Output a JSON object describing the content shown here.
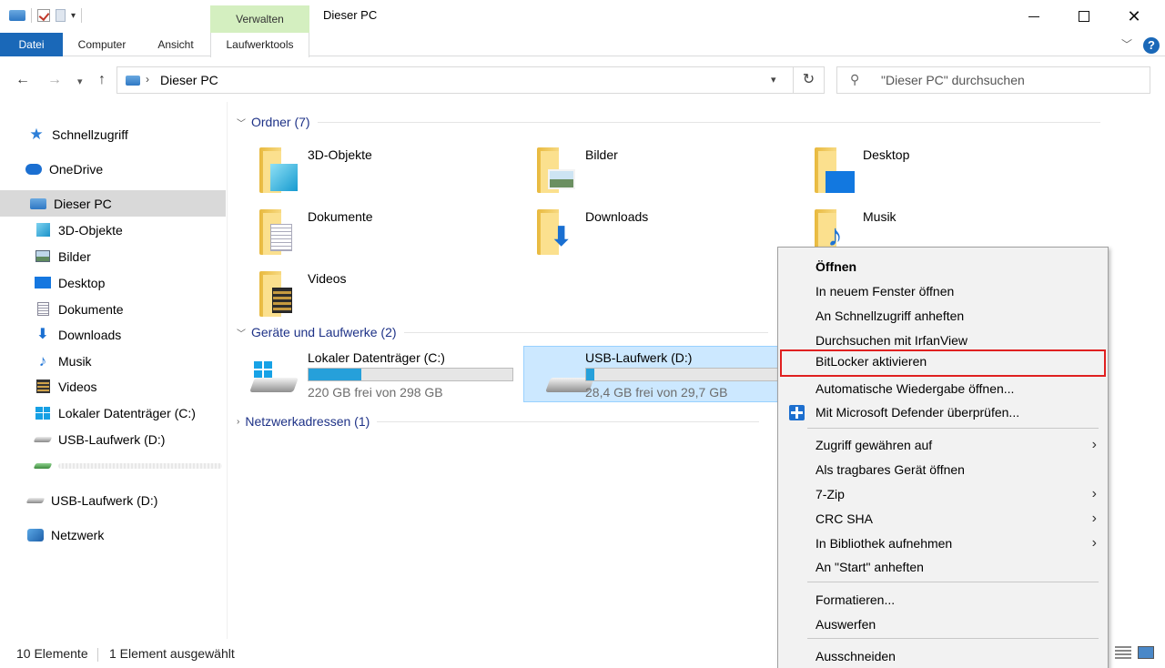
{
  "window": {
    "title": "Dieser PC",
    "context_tab_group": "Verwalten",
    "controls": {
      "minimize": "–",
      "maximize": "☐",
      "close": "✕"
    }
  },
  "ribbon": {
    "tabs": [
      "Datei",
      "Computer",
      "Ansicht",
      "Laufwerktools"
    ],
    "help": "?"
  },
  "address_bar": {
    "path": "Dieser PC",
    "search_placeholder": "\"Dieser PC\" durchsuchen"
  },
  "sidebar": {
    "items": [
      {
        "label": "Schnellzugriff",
        "icon": "star-icon"
      },
      {
        "label": "OneDrive",
        "icon": "cloud-icon"
      },
      {
        "label": "Dieser PC",
        "icon": "computer-icon",
        "selected": true
      },
      {
        "label": "3D-Objekte",
        "icon": "cube-icon"
      },
      {
        "label": "Bilder",
        "icon": "pictures-icon"
      },
      {
        "label": "Desktop",
        "icon": "desktop-icon"
      },
      {
        "label": "Dokumente",
        "icon": "documents-icon"
      },
      {
        "label": "Downloads",
        "icon": "download-icon"
      },
      {
        "label": "Musik",
        "icon": "music-icon"
      },
      {
        "label": "Videos",
        "icon": "video-icon"
      },
      {
        "label": "Lokaler Datenträger (C:)",
        "icon": "windows-drive-icon"
      },
      {
        "label": "USB-Laufwerk (D:)",
        "icon": "usb-drive-icon"
      },
      {
        "label": "",
        "icon": "usb-drive-icon"
      },
      {
        "label": "USB-Laufwerk (D:)",
        "icon": "usb-drive-icon"
      },
      {
        "label": "Netzwerk",
        "icon": "network-icon"
      }
    ]
  },
  "content": {
    "groups": {
      "folders": "Ordner (7)",
      "drives": "Geräte und Laufwerke (2)",
      "network": "Netzwerkadressen (1)"
    },
    "folders": [
      "3D-Objekte",
      "Bilder",
      "Desktop",
      "Dokumente",
      "Downloads",
      "Musik",
      "Videos"
    ],
    "drives": [
      {
        "name": "Lokaler Datenträger (C:)",
        "free": "220 GB frei von 298 GB",
        "used_fraction": 0.26
      },
      {
        "name": "USB-Laufwerk (D:)",
        "free": "28,4 GB frei von 29,7 GB",
        "used_fraction": 0.044,
        "selected": true
      }
    ]
  },
  "context_menu": {
    "items": [
      "Öffnen",
      "In neuem Fenster öffnen",
      "An Schnellzugriff anheften",
      "Durchsuchen mit IrfanView",
      "BitLocker aktivieren",
      "Automatische Wiedergabe öffnen...",
      "Mit Microsoft Defender überprüfen...",
      "Zugriff gewähren auf",
      "Als tragbares Gerät öffnen",
      "7-Zip",
      "CRC SHA",
      "In Bibliothek aufnehmen",
      "An \"Start\" anheften",
      "Formatieren...",
      "Auswerfen",
      "Ausschneiden"
    ],
    "highlighted": "BitLocker aktivieren",
    "highlight_color": "#e02020"
  },
  "status_bar": {
    "count": "10 Elemente",
    "selection": "1 Element ausgewählt"
  },
  "colors": {
    "accent": "#1a68b8",
    "selection": "#cce8ff",
    "drive_bar": "#26a0da",
    "context_tab": "#d4efc0"
  }
}
